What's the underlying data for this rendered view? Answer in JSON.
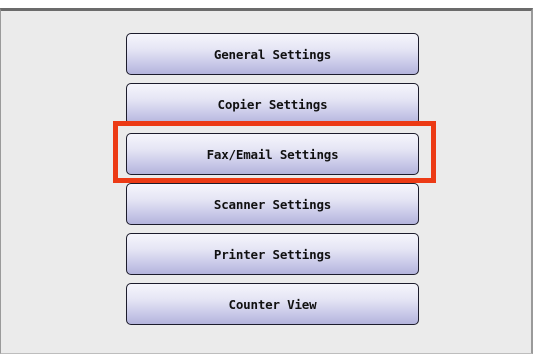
{
  "menu": {
    "items": [
      {
        "label": "General Settings"
      },
      {
        "label": "Copier Settings"
      },
      {
        "label": "Fax/Email Settings",
        "highlighted": true
      },
      {
        "label": "Scanner Settings"
      },
      {
        "label": "Printer Settings"
      },
      {
        "label": "Counter View"
      }
    ]
  },
  "colors": {
    "highlight_border": "#ec3a15",
    "panel_background": "#ebebeb",
    "button_gradient_top": "#f6f6fc",
    "button_gradient_bottom": "#b4b4dc"
  }
}
